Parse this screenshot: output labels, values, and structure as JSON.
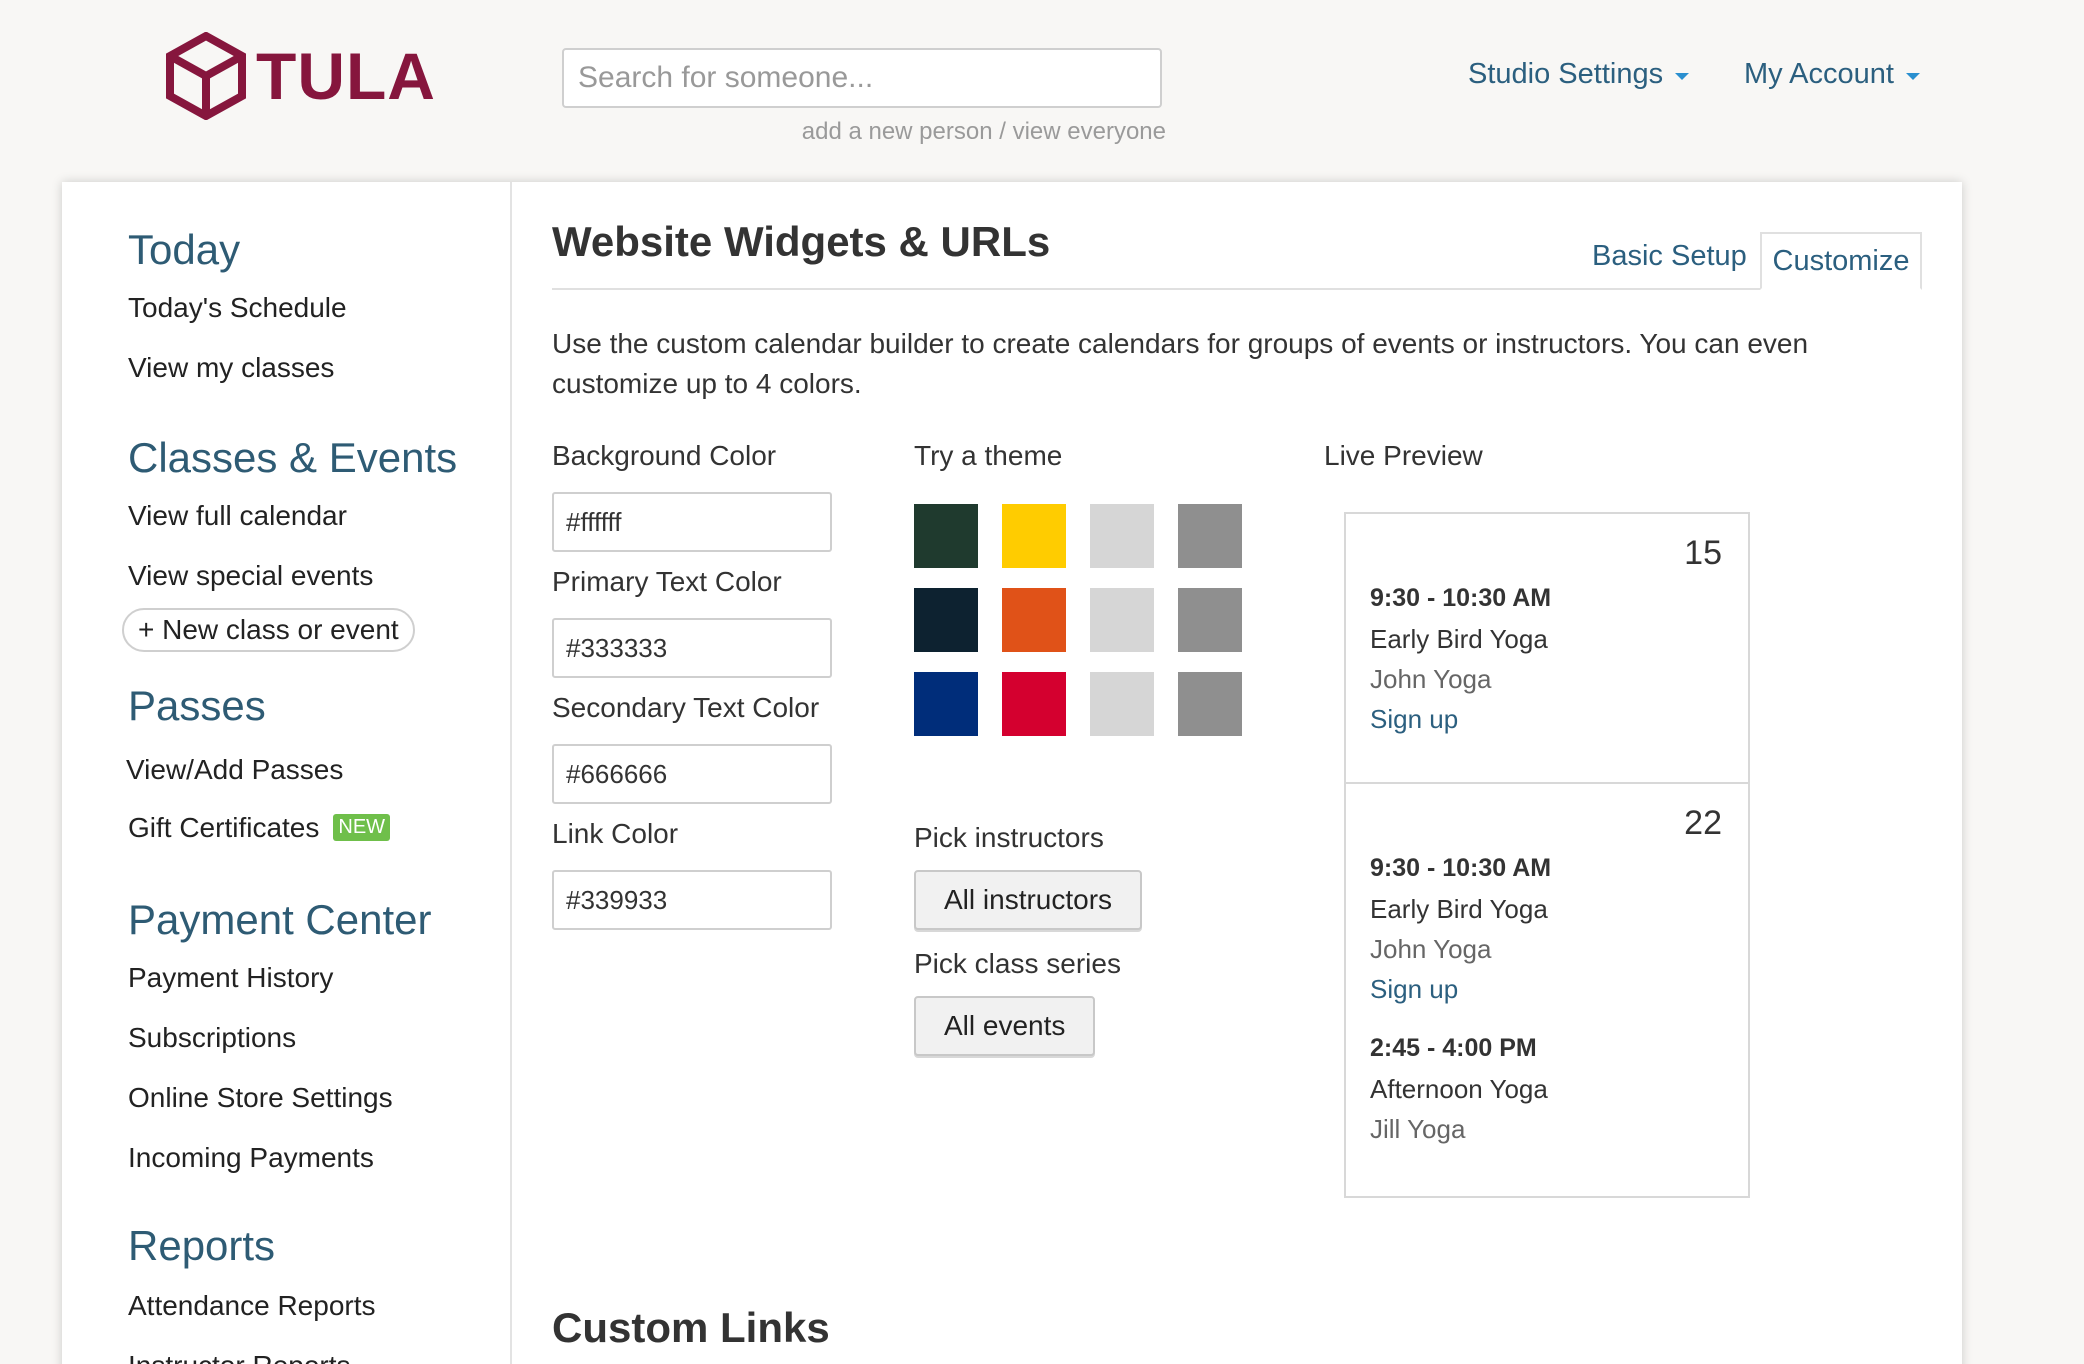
{
  "header": {
    "logo_text": "TULA",
    "search_placeholder": "Search for someone...",
    "add_person": "add a new person",
    "separator": " / ",
    "view_everyone": "view everyone",
    "nav": [
      {
        "label": "Studio Settings"
      },
      {
        "label": "My Account"
      }
    ]
  },
  "sidebar": {
    "sections": [
      {
        "title": "Today",
        "items": [
          "Today's Schedule",
          "View my classes"
        ]
      },
      {
        "title": "Classes & Events",
        "items": [
          "View full calendar",
          "View special events"
        ],
        "action": "+ New class or event"
      },
      {
        "title": "Passes",
        "items": [
          "View/Add Passes",
          "Gift Certificates"
        ],
        "badge": "NEW"
      },
      {
        "title": "Payment Center",
        "items": [
          "Payment History",
          "Subscriptions",
          "Online Store Settings",
          "Incoming Payments"
        ]
      },
      {
        "title": "Reports",
        "items": [
          "Attendance Reports",
          "Instructor Reports"
        ]
      }
    ]
  },
  "main": {
    "title": "Website Widgets & URLs",
    "tabs": [
      {
        "label": "Basic Setup"
      },
      {
        "label": "Customize",
        "active": true
      }
    ],
    "intro": "Use the custom calendar builder to create calendars for groups of events or instructors. You can even customize up to 4 colors.",
    "colors": [
      {
        "label": "Background Color",
        "value": "#ffffff"
      },
      {
        "label": "Primary Text Color",
        "value": "#333333"
      },
      {
        "label": "Secondary Text Color",
        "value": "#666666"
      },
      {
        "label": "Link Color",
        "value": "#339933"
      }
    ],
    "theme_label": "Try a theme",
    "themes": [
      [
        "#1f3a2e",
        "#ffcc00",
        "#d6d6d6",
        "#8f8f8f"
      ],
      [
        "#0d2230",
        "#e05218",
        "#d6d6d6",
        "#8f8f8f"
      ],
      [
        "#002d7a",
        "#d4002f",
        "#d6d6d6",
        "#8f8f8f"
      ]
    ],
    "pick_instructors_label": "Pick instructors",
    "instructors_button": "All instructors",
    "pick_series_label": "Pick class series",
    "series_button": "All events",
    "preview_label": "Live Preview",
    "preview": {
      "days": [
        {
          "day": "15",
          "events": [
            {
              "time": "9:30 - 10:30 AM",
              "name": "Early Bird Yoga",
              "instructor": "John Yoga",
              "link": "Sign up"
            }
          ]
        },
        {
          "day": "22",
          "events": [
            {
              "time": "9:30 - 10:30 AM",
              "name": "Early Bird Yoga",
              "instructor": "John Yoga",
              "link": "Sign up"
            },
            {
              "time": "2:45 - 4:00 PM",
              "name": "Afternoon Yoga",
              "instructor": "Jill Yoga"
            }
          ]
        }
      ]
    },
    "custom_links_title": "Custom Links"
  },
  "colors": {
    "brand": "#86163d",
    "link": "#2b5f7f",
    "heading": "#2e5b74",
    "badge": "#6fbf4a"
  }
}
